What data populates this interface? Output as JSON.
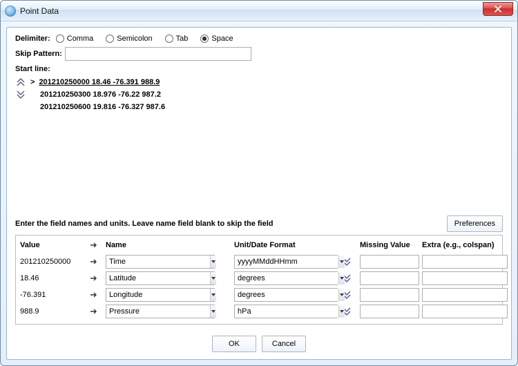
{
  "window": {
    "title": "Point Data"
  },
  "delimiter": {
    "label": "Delimiter:",
    "options": {
      "comma": "Comma",
      "semicolon": "Semicolon",
      "tab": "Tab",
      "space": "Space"
    },
    "selected": "space"
  },
  "skip": {
    "label": "Skip Pattern:",
    "value": ""
  },
  "startline": {
    "label": "Start line:"
  },
  "lines": {
    "current_marker": ">",
    "rows": [
      "201210250000 18.46 -76.391 988.9",
      "201210250300 18.976 -76.22 987.2",
      "201210250600 19.816 -76.327 987.6"
    ]
  },
  "instruction": "Enter the field names and units. Leave name field blank to skip the field",
  "preferences_label": "Preferences",
  "table": {
    "headers": {
      "value": "Value",
      "name": "Name",
      "unit": "Unit/Date Format",
      "missing": "Missing Value",
      "extra": "Extra (e.g., colspan)"
    },
    "rows": [
      {
        "value": "201210250000",
        "name": "Time",
        "unit": "yyyyMMddHHmm",
        "missing": "",
        "extra": ""
      },
      {
        "value": "18.46",
        "name": "Latitude",
        "unit": "degrees",
        "missing": "",
        "extra": ""
      },
      {
        "value": "-76.391",
        "name": "Longitude",
        "unit": "degrees",
        "missing": "",
        "extra": ""
      },
      {
        "value": "988.9",
        "name": "Pressure",
        "unit": "hPa",
        "missing": "",
        "extra": ""
      }
    ]
  },
  "buttons": {
    "ok": "OK",
    "cancel": "Cancel"
  }
}
